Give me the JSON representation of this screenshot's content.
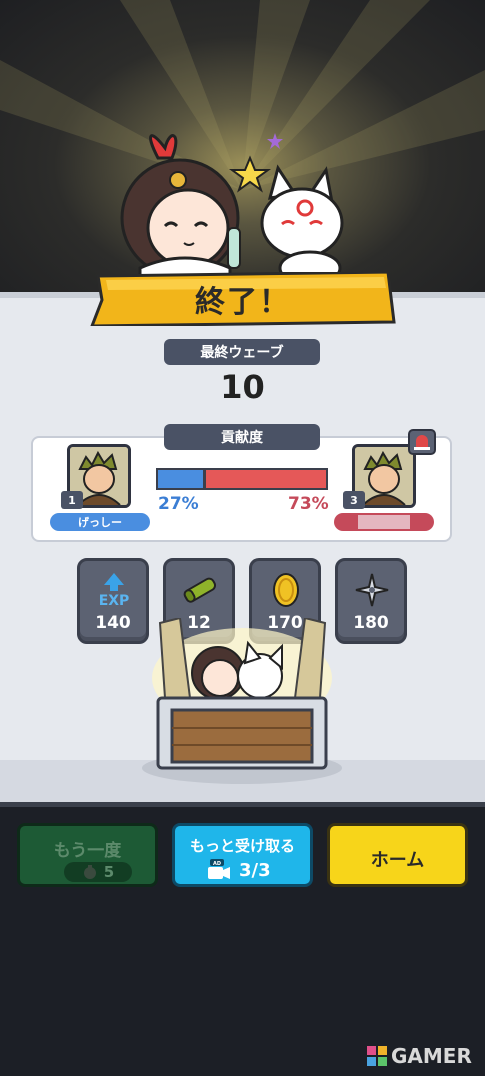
{
  "result": {
    "title": "終了！",
    "final_wave_label": "最終ウェーブ",
    "final_wave_value": "10",
    "contribution_label": "貢献度"
  },
  "players": [
    {
      "rank": "1",
      "name": "げっしー",
      "percent": "27%",
      "share": 0.27,
      "color": "#4a8ee0"
    },
    {
      "rank": "3",
      "name": "",
      "percent": "73%",
      "share": 0.73,
      "color": "#c54a5a"
    }
  ],
  "rewards": [
    {
      "icon": "exp-icon",
      "icon_text": "EXP",
      "value": "140"
    },
    {
      "icon": "scroll-icon",
      "value": "12"
    },
    {
      "icon": "gold-coin-icon",
      "value": "170"
    },
    {
      "icon": "shuriken-icon",
      "value": "180"
    }
  ],
  "buttons": {
    "retry_label": "もう一度",
    "retry_cost": "5",
    "more_label": "もっと受け取る",
    "more_ad_tag": "AD",
    "more_count": "3/3",
    "home_label": "ホーム"
  },
  "colors": {
    "banner": "#f2b51a",
    "retry": "#1d5a35",
    "more": "#1fb6ea",
    "home": "#f7d51a"
  },
  "watermark": {
    "text": "GAMER"
  }
}
